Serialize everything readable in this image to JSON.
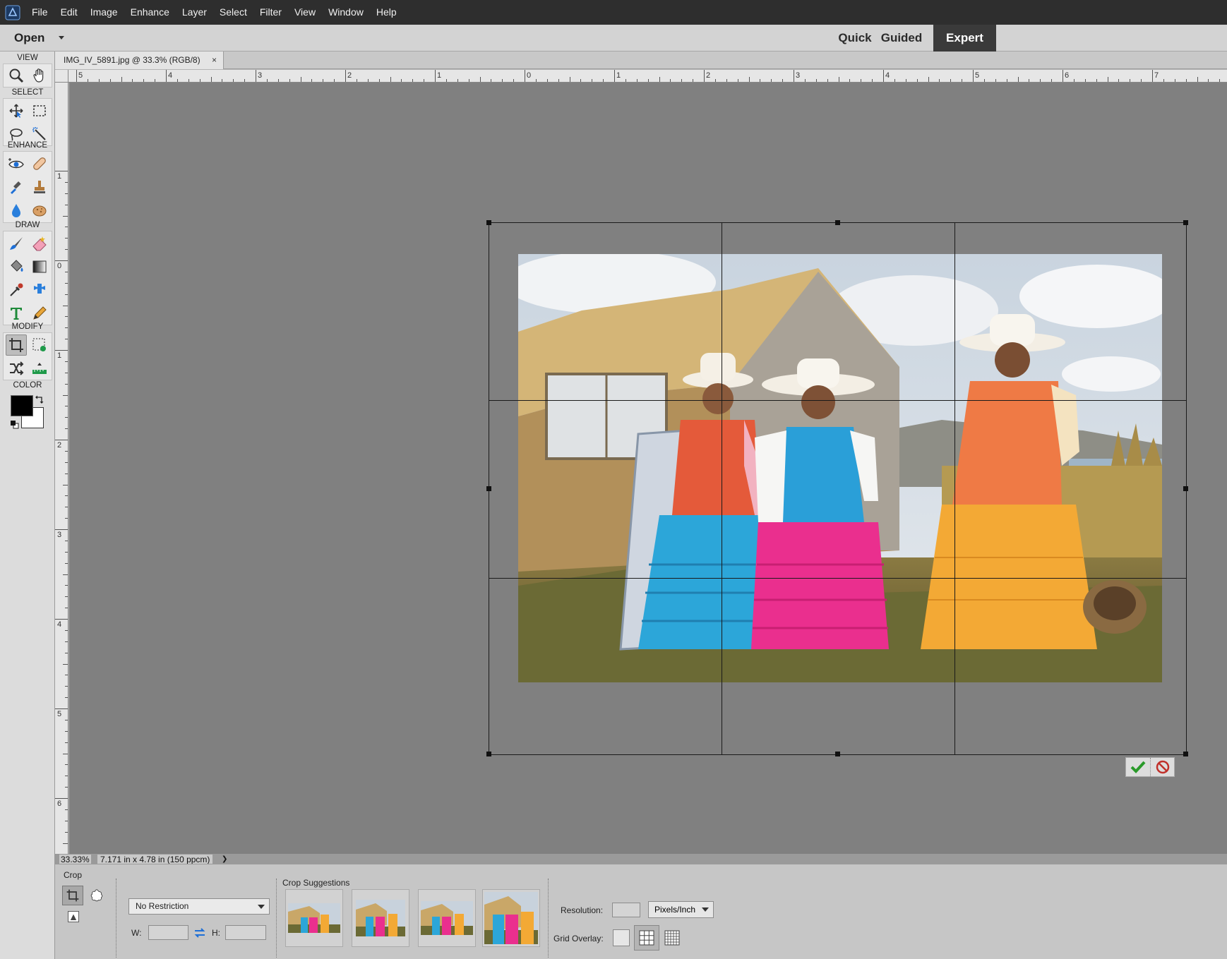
{
  "menubar": {
    "items": [
      "File",
      "Edit",
      "Image",
      "Enhance",
      "Layer",
      "Select",
      "Filter",
      "View",
      "Window",
      "Help"
    ]
  },
  "modebar": {
    "open_label": "Open",
    "tabs": [
      "Quick",
      "Guided",
      "Expert"
    ],
    "active_tab": "Expert"
  },
  "toolbox": {
    "sections": [
      "VIEW",
      "SELECT",
      "ENHANCE",
      "DRAW",
      "MODIFY",
      "COLOR"
    ],
    "foreground_color": "#000000",
    "background_color": "#ffffff"
  },
  "document": {
    "tab_title": "IMG_IV_5891.jpg @ 33.3% (RGB/8)",
    "close_glyph": "×"
  },
  "rulers": {
    "horizontal": [
      "5",
      "4",
      "3",
      "2",
      "1",
      "0",
      "1",
      "2",
      "3",
      "4",
      "5",
      "6",
      "7"
    ],
    "vertical": [
      "1",
      "0",
      "1",
      "2",
      "3",
      "4",
      "5",
      "6"
    ]
  },
  "status": {
    "zoom": "33.33%",
    "doc_size": "7.171 in x 4.78 in (150 ppcm)",
    "expand_glyph": "❯"
  },
  "options": {
    "tool_title": "Crop",
    "restriction": "No Restriction",
    "width_label": "W:",
    "height_label": "H:",
    "width_value": "",
    "height_value": "",
    "suggestions_label": "Crop Suggestions",
    "resolution_label": "Resolution:",
    "resolution_value": "",
    "resolution_units": "Pixels/Inch",
    "grid_overlay_label": "Grid Overlay:"
  }
}
